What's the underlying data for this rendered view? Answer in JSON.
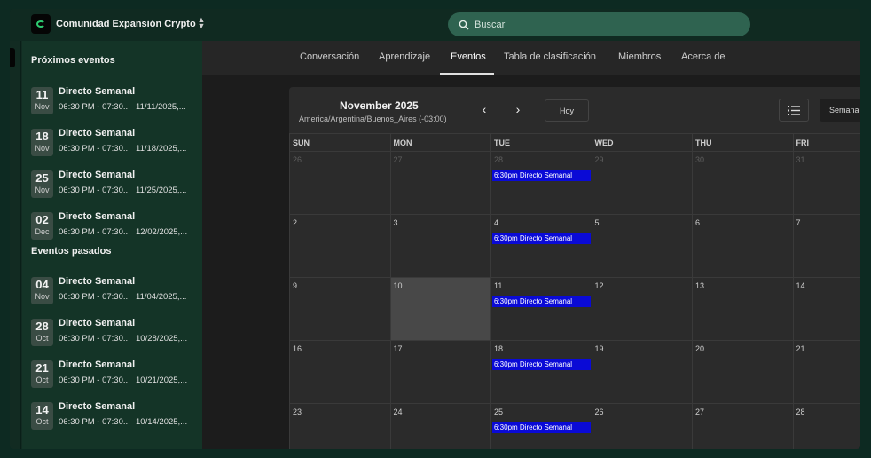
{
  "app": {
    "title": "Comunidad Expansión Crypto"
  },
  "search": {
    "placeholder": "Buscar"
  },
  "sidebar": {
    "upcoming_title": "Próximos eventos",
    "upcoming": [
      {
        "day": "11",
        "month": "Nov",
        "title": "Directo Semanal",
        "time": "06:30 PM - 07:30...",
        "date": "11/11/2025,..."
      },
      {
        "day": "18",
        "month": "Nov",
        "title": "Directo Semanal",
        "time": "06:30 PM - 07:30...",
        "date": "11/18/2025,..."
      },
      {
        "day": "25",
        "month": "Nov",
        "title": "Directo Semanal",
        "time": "06:30 PM - 07:30...",
        "date": "11/25/2025,..."
      },
      {
        "day": "02",
        "month": "Dec",
        "title": "Directo Semanal",
        "time": "06:30 PM - 07:30...",
        "date": "12/02/2025,..."
      }
    ],
    "past_title": "Eventos pasados",
    "past": [
      {
        "day": "04",
        "month": "Nov",
        "title": "Directo Semanal",
        "time": "06:30 PM - 07:30...",
        "date": "11/04/2025,..."
      },
      {
        "day": "28",
        "month": "Oct",
        "title": "Directo Semanal",
        "time": "06:30 PM - 07:30...",
        "date": "10/28/2025,..."
      },
      {
        "day": "21",
        "month": "Oct",
        "title": "Directo Semanal",
        "time": "06:30 PM - 07:30...",
        "date": "10/21/2025,..."
      },
      {
        "day": "14",
        "month": "Oct",
        "title": "Directo Semanal",
        "time": "06:30 PM - 07:30...",
        "date": "10/14/2025,..."
      }
    ]
  },
  "tabs": [
    {
      "label": "Conversación",
      "active": false
    },
    {
      "label": "Aprendizaje",
      "active": false
    },
    {
      "label": "Eventos",
      "active": true
    },
    {
      "label": "Tabla de clasificación",
      "active": false
    },
    {
      "label": "Miembros",
      "active": false
    },
    {
      "label": "Acerca de",
      "active": false
    }
  ],
  "calendar": {
    "month_title": "November 2025",
    "timezone": "America/Argentina/Buenos_Aires (-03:00)",
    "today_label": "Hoy",
    "view_label": "Semana",
    "weekdays": [
      "SUN",
      "MON",
      "TUE",
      "WED",
      "THU",
      "FRI"
    ],
    "weeks": [
      [
        "26",
        "27",
        "28",
        "29",
        "30",
        "31"
      ],
      [
        "2",
        "3",
        "4",
        "5",
        "6",
        "7"
      ],
      [
        "9",
        "10",
        "11",
        "12",
        "13",
        "14"
      ],
      [
        "16",
        "17",
        "18",
        "19",
        "20",
        "21"
      ],
      [
        "23",
        "24",
        "25",
        "26",
        "27",
        "28"
      ]
    ],
    "outside_month_week": 0,
    "today": "10",
    "event_label": "6:30pm Directo Semanal",
    "event_weekday": "TUE",
    "colors": {
      "event": "#0a0ad6",
      "today_cell": "#484848"
    }
  }
}
